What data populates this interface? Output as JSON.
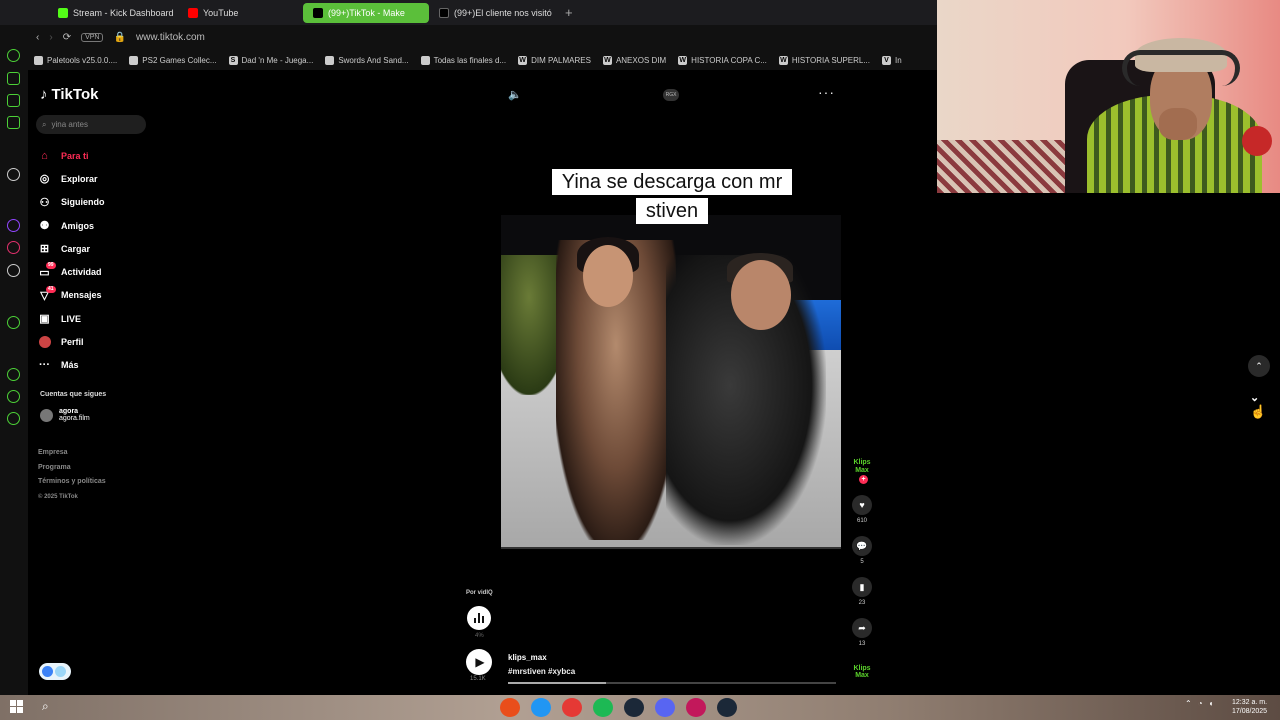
{
  "browser": {
    "tabs": [
      {
        "label": "Stream - Kick Dashboard",
        "color": "#53fc18",
        "active": false
      },
      {
        "label": "YouTube",
        "color": "#ff0000",
        "active": false
      },
      {
        "label": "(99+)TikTok - Make",
        "color": "#ffffff",
        "active": true
      },
      {
        "label": "(99+)El cliente nos visitó",
        "color": "#ffffff",
        "active": false
      }
    ],
    "new_tab_glyph": "+",
    "vpn_label": "VPN",
    "url": "www.tiktok.com",
    "bookmarks": [
      {
        "label": "Paletools v25.0.0....",
        "glyph": ""
      },
      {
        "label": "PS2 Games Collec...",
        "glyph": ""
      },
      {
        "label": "Dad 'n Me - Juega...",
        "glyph": "S"
      },
      {
        "label": "Swords And Sand...",
        "glyph": ""
      },
      {
        "label": "Todas las finales d...",
        "glyph": ""
      },
      {
        "label": "DIM PALMARES",
        "glyph": "W"
      },
      {
        "label": "ANEXOS DIM",
        "glyph": "W"
      },
      {
        "label": "HISTORIA COPA C...",
        "glyph": "W"
      },
      {
        "label": "HISTORIA SUPERL...",
        "glyph": "W"
      },
      {
        "label": "In",
        "glyph": "V"
      }
    ]
  },
  "tiktok": {
    "logo": "TikTok",
    "search_value": "yina antes",
    "nav": [
      {
        "label": "Para ti",
        "icon": "home-icon",
        "active": true,
        "badge": ""
      },
      {
        "label": "Explorar",
        "icon": "compass-icon",
        "active": false,
        "badge": ""
      },
      {
        "label": "Siguiendo",
        "icon": "user-follow-icon",
        "active": false,
        "badge": ""
      },
      {
        "label": "Amigos",
        "icon": "friends-icon",
        "active": false,
        "badge": ""
      },
      {
        "label": "Cargar",
        "icon": "upload-icon",
        "active": false,
        "badge": ""
      },
      {
        "label": "Actividad",
        "icon": "activity-icon",
        "active": false,
        "badge": "99"
      },
      {
        "label": "Mensajes",
        "icon": "messages-icon",
        "active": false,
        "badge": "41"
      },
      {
        "label": "LIVE",
        "icon": "live-icon",
        "active": false,
        "badge": ""
      },
      {
        "label": "Perfil",
        "icon": "profile-avatar",
        "active": false,
        "badge": ""
      },
      {
        "label": "Más",
        "icon": "more-dots-icon",
        "active": false,
        "badge": ""
      }
    ],
    "following_title": "Cuentas que sigues",
    "following": [
      {
        "name": "agora",
        "handle": "agora.film"
      }
    ],
    "footer": [
      "Empresa",
      "Programa",
      "Términos y políticas"
    ],
    "copyright": "© 2025 TikTok"
  },
  "video": {
    "badge": "RGX",
    "caption": "Yina se descarga con mr stiven",
    "creator_badge": "Klips Max",
    "likes": "610",
    "comments": "5",
    "saves": "23",
    "shares": "13",
    "author_tag": "Por vidIQ",
    "score_pct": "4%",
    "views": "15.1K",
    "username": "klips_max",
    "hashtags": "#mrstiven #xybca",
    "progress": 0.3
  },
  "taskbar": {
    "clock_time": "12:32 a. m.",
    "clock_date": "17/08/2025",
    "app_colors": [
      "#e94e1b",
      "#2196f3",
      "#e53935",
      "#1db954",
      "#1b2838",
      "#5865f2",
      "#c2185b",
      "#1b2838"
    ]
  },
  "colors": {
    "tiktok_accent": "#fe2c55",
    "opera_green": "#5bbf3a"
  }
}
